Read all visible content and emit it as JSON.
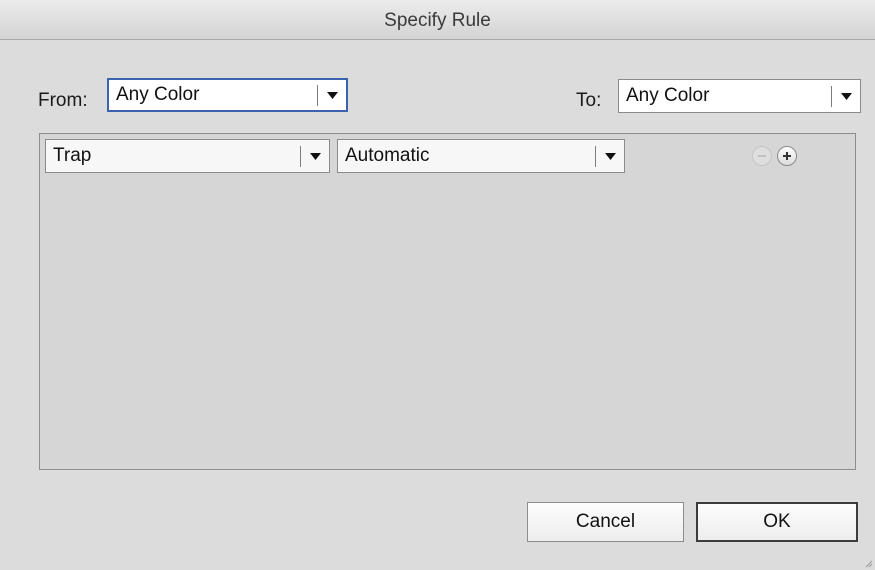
{
  "dialog": {
    "title": "Specify Rule"
  },
  "from": {
    "label": "From:",
    "value": "Any Color"
  },
  "to": {
    "label": "To:",
    "value": "Any Color"
  },
  "rule": {
    "type_value": "Trap",
    "mode_value": "Automatic",
    "remove_icon": "minus-circle-icon",
    "add_icon": "plus-circle-icon"
  },
  "buttons": {
    "cancel": "Cancel",
    "ok": "OK"
  },
  "colors": {
    "focus_ring": "#3b62ad",
    "dialog_bg": "#dcdcdc"
  }
}
